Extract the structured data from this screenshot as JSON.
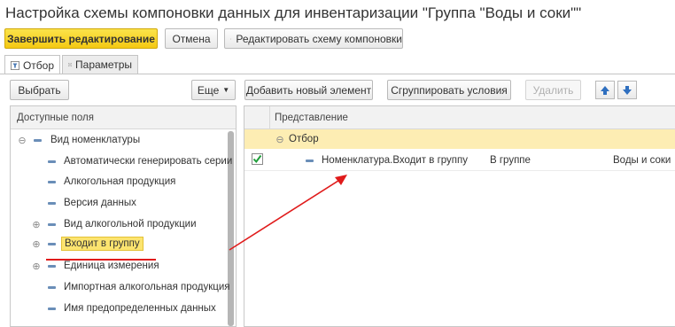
{
  "window": {
    "title": "Настройка схемы компоновки данных для инвентаризации \"Группа \"Воды и соки\"\""
  },
  "toolbar": {
    "finish_label": "Завершить редактирование",
    "cancel_label": "Отмена",
    "edit_schema_label": "Редактировать схему компоновки"
  },
  "tabs": [
    {
      "label": "Отбор",
      "icon": "filter-icon",
      "active": true
    },
    {
      "label": "Параметры",
      "icon": "params-icon",
      "active": false
    }
  ],
  "left": {
    "select_label": "Выбрать",
    "more_label": "Еще",
    "header": "Доступные поля",
    "items": [
      {
        "label": "Вид номенклатуры",
        "expander": "⊖"
      },
      {
        "label": "Автоматически генерировать серии",
        "expander": ""
      },
      {
        "label": "Алкогольная продукция",
        "expander": ""
      },
      {
        "label": "Версия данных",
        "expander": ""
      },
      {
        "label": "Вид алкогольной продукции",
        "expander": "⊕"
      },
      {
        "label": "Входит в группу",
        "expander": "⊕"
      },
      {
        "label": "Единица измерения",
        "expander": "⊕"
      },
      {
        "label": "Импортная алкогольная продукция",
        "expander": ""
      },
      {
        "label": "Имя предопределенных данных",
        "expander": ""
      }
    ]
  },
  "right": {
    "add_label": "Добавить новый элемент",
    "group_label": "Сгруппировать условия",
    "delete_label": "Удалить",
    "header": "Представление",
    "group_row": {
      "expander": "⊖",
      "label": "Отбор"
    },
    "filter_row": {
      "checked": true,
      "field": "Номенклатура.Входит в группу",
      "condition": "В группе",
      "value": "Воды и соки"
    }
  },
  "colors": {
    "accent": "#f4c913",
    "highlight": "#fce46f",
    "annotation": "#e01b1b"
  }
}
